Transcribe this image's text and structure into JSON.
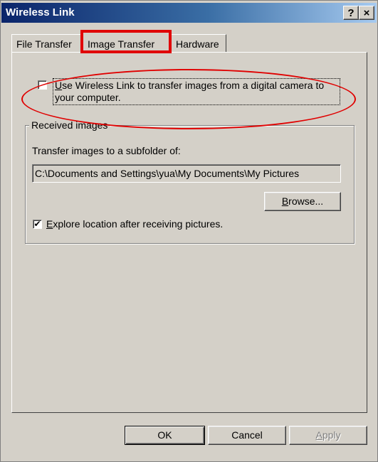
{
  "window": {
    "title": "Wireless Link",
    "help_glyph": "?",
    "close_glyph": "×"
  },
  "tabs": [
    {
      "label": "File Transfer"
    },
    {
      "label": "Image Transfer",
      "active": true
    },
    {
      "label": "Hardware"
    }
  ],
  "image_transfer": {
    "use_checkbox": {
      "checked": false,
      "mnemonic": "U",
      "label_rest": "se  Wireless Link to transfer images from a digital camera to your computer."
    },
    "received_group": {
      "legend": "Received images",
      "subfolder_label": "Transfer images to a subfolder of:",
      "path": "C:\\Documents and Settings\\yua\\My Documents\\My Pictures",
      "browse": {
        "mnemonic": "B",
        "rest": "rowse..."
      },
      "explore_checkbox": {
        "checked": true,
        "check_glyph": "✔",
        "mnemonic": "E",
        "label_rest": "xplore location after receiving pictures."
      }
    }
  },
  "buttons": {
    "ok": "OK",
    "cancel": "Cancel",
    "apply_mnemonic": "A",
    "apply_rest": "pply"
  },
  "annotations": {
    "highlight_color": "#e00000"
  }
}
